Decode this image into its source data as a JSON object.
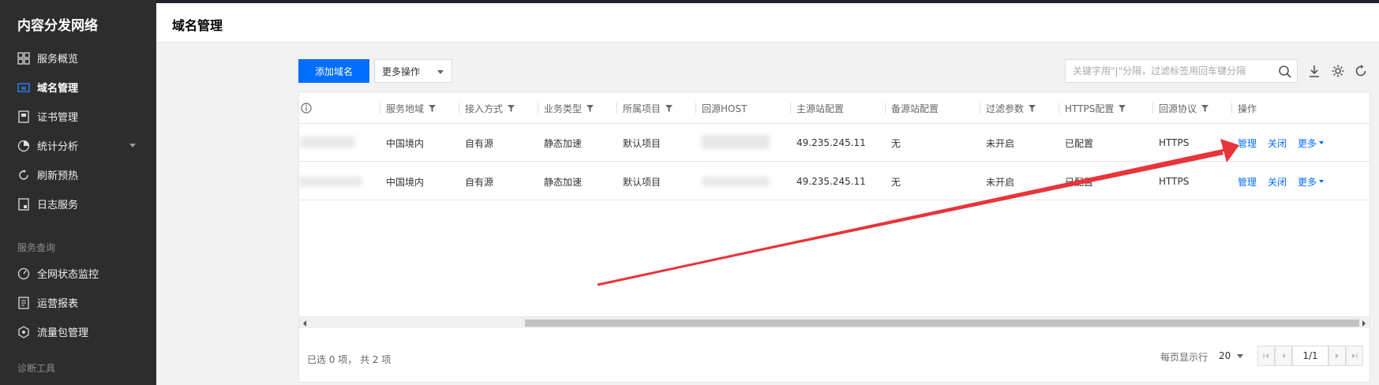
{
  "sidebar": {
    "title": "内容分发网络",
    "items": [
      {
        "label": "服务概览",
        "icon": "grid-icon"
      },
      {
        "label": "域名管理",
        "icon": "domain-icon"
      },
      {
        "label": "证书管理",
        "icon": "certificate-icon"
      },
      {
        "label": "统计分析",
        "icon": "pie-chart-icon"
      },
      {
        "label": "刷新预热",
        "icon": "refresh-icon"
      },
      {
        "label": "日志服务",
        "icon": "log-icon"
      }
    ],
    "group_query": "服务查询",
    "query_items": [
      {
        "label": "全网状态监控",
        "icon": "gauge-icon"
      },
      {
        "label": "运营报表",
        "icon": "report-icon"
      },
      {
        "label": "流量包管理",
        "icon": "package-icon"
      }
    ],
    "group_diag": "诊断工具"
  },
  "header": {
    "title": "域名管理"
  },
  "toolbar": {
    "add_label": "添加域名",
    "more_ops_label": "更多操作",
    "search_placeholder": "关键字用\"|\"分隔，过滤标签用回车键分隔"
  },
  "table": {
    "columns": [
      "服务地域",
      "接入方式",
      "业务类型",
      "所属项目",
      "回源HOST",
      "主源站配置",
      "备源站配置",
      "过滤参数",
      "HTTPS配置",
      "回源协议",
      "操作"
    ],
    "rows": [
      {
        "region": "中国境内",
        "access": "自有源",
        "biz_type": "静态加速",
        "project": "默认项目",
        "origin": "49.235.245.11",
        "backup": "无",
        "filter": "未开启",
        "https": "已配置",
        "protocol": "HTTPS",
        "op_manage": "管理",
        "op_close": "关闭",
        "op_more": "更多"
      },
      {
        "region": "中国境内",
        "access": "自有源",
        "biz_type": "静态加速",
        "project": "默认项目",
        "origin": "49.235.245.11",
        "backup": "无",
        "filter": "未开启",
        "https": "已配置",
        "protocol": "HTTPS",
        "op_manage": "管理",
        "op_close": "关闭",
        "op_more": "更多"
      }
    ]
  },
  "footer": {
    "summary": "已选 0 项， 共 2 项",
    "page_size_label": "每页显示行",
    "page_size": "20",
    "page_indicator": "1/1"
  },
  "colors": {
    "primary": "#006eff",
    "sidebar_bg": "#2d2d2d",
    "annotation_arrow": "#e8343a"
  }
}
